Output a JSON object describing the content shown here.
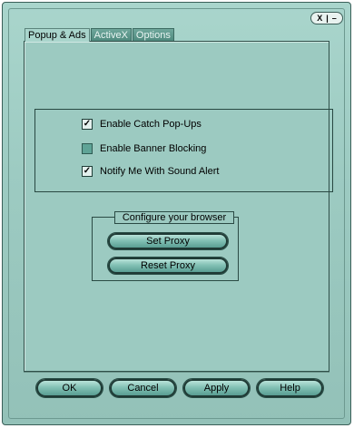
{
  "window": {
    "controls": [
      "X",
      "|",
      "–"
    ]
  },
  "tabs": [
    {
      "label": "Popup & Ads",
      "active": true
    },
    {
      "label": "ActiveX",
      "active": false
    },
    {
      "label": "Options",
      "active": false
    }
  ],
  "options": [
    {
      "label": "Enable Catch Pop-Ups",
      "checked": true,
      "check_glyph": "✓"
    },
    {
      "label": "Enable Banner Blocking",
      "checked": false,
      "check_glyph": ""
    },
    {
      "label": "Notify Me With Sound Alert",
      "checked": true,
      "check_glyph": "✓"
    }
  ],
  "browser_group": {
    "title": "Configure your browser",
    "set_proxy": "Set Proxy",
    "reset_proxy": "Reset Proxy"
  },
  "footer": {
    "ok": "OK",
    "cancel": "Cancel",
    "apply": "Apply",
    "help": "Help"
  },
  "colors": {
    "background": "#a9d5cc",
    "accent": "#4f958a",
    "border": "#2f4f49"
  }
}
